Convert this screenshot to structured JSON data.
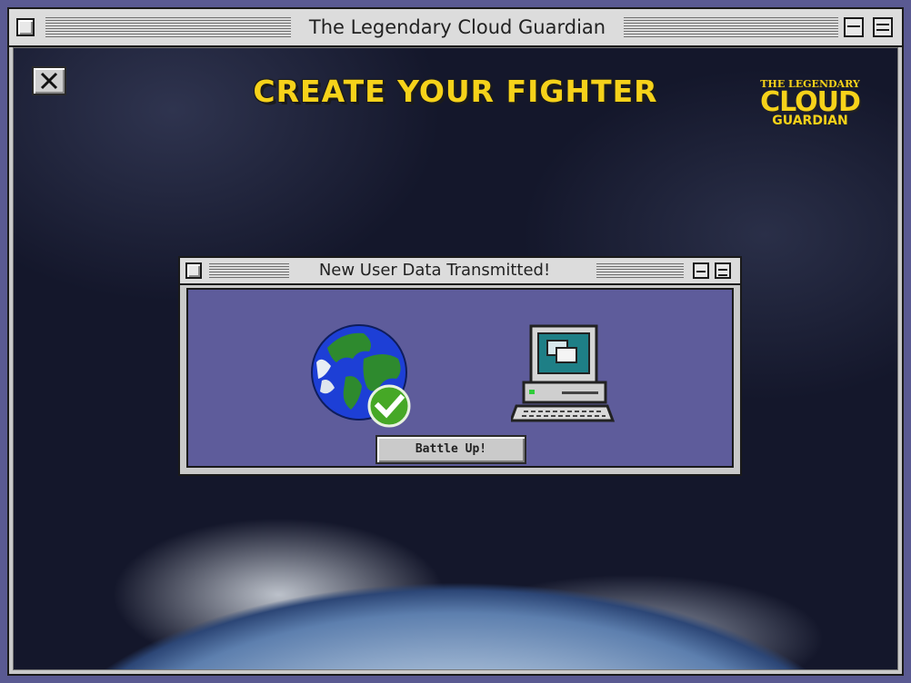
{
  "window": {
    "title": "The Legendary Cloud Guardian"
  },
  "screen": {
    "heading": "CREATE YOUR FIGHTER",
    "logo": {
      "line1": "THE LEGENDARY",
      "line2": "CLOUD",
      "line3": "GUARDIAN"
    },
    "close_icon": "close-x-icon"
  },
  "dialog": {
    "title": "New User Data Transmitted!",
    "button_label": "Battle Up!",
    "icons": [
      "globe-icon",
      "check-badge-icon",
      "computer-icon"
    ]
  },
  "colors": {
    "dialog_body": "#5e5c9b",
    "heading_yellow": "#f6d21a",
    "check_green": "#46a826"
  }
}
